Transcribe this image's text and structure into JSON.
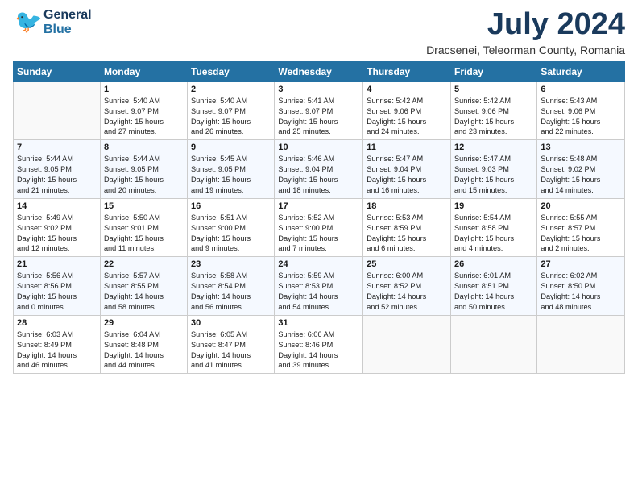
{
  "header": {
    "logo_general": "General",
    "logo_blue": "Blue",
    "month_year": "July 2024",
    "location": "Dracsenei, Teleorman County, Romania"
  },
  "weekdays": [
    "Sunday",
    "Monday",
    "Tuesday",
    "Wednesday",
    "Thursday",
    "Friday",
    "Saturday"
  ],
  "weeks": [
    [
      {
        "day": "",
        "info": ""
      },
      {
        "day": "1",
        "info": "Sunrise: 5:40 AM\nSunset: 9:07 PM\nDaylight: 15 hours\nand 27 minutes."
      },
      {
        "day": "2",
        "info": "Sunrise: 5:40 AM\nSunset: 9:07 PM\nDaylight: 15 hours\nand 26 minutes."
      },
      {
        "day": "3",
        "info": "Sunrise: 5:41 AM\nSunset: 9:07 PM\nDaylight: 15 hours\nand 25 minutes."
      },
      {
        "day": "4",
        "info": "Sunrise: 5:42 AM\nSunset: 9:06 PM\nDaylight: 15 hours\nand 24 minutes."
      },
      {
        "day": "5",
        "info": "Sunrise: 5:42 AM\nSunset: 9:06 PM\nDaylight: 15 hours\nand 23 minutes."
      },
      {
        "day": "6",
        "info": "Sunrise: 5:43 AM\nSunset: 9:06 PM\nDaylight: 15 hours\nand 22 minutes."
      }
    ],
    [
      {
        "day": "7",
        "info": "Sunrise: 5:44 AM\nSunset: 9:05 PM\nDaylight: 15 hours\nand 21 minutes."
      },
      {
        "day": "8",
        "info": "Sunrise: 5:44 AM\nSunset: 9:05 PM\nDaylight: 15 hours\nand 20 minutes."
      },
      {
        "day": "9",
        "info": "Sunrise: 5:45 AM\nSunset: 9:05 PM\nDaylight: 15 hours\nand 19 minutes."
      },
      {
        "day": "10",
        "info": "Sunrise: 5:46 AM\nSunset: 9:04 PM\nDaylight: 15 hours\nand 18 minutes."
      },
      {
        "day": "11",
        "info": "Sunrise: 5:47 AM\nSunset: 9:04 PM\nDaylight: 15 hours\nand 16 minutes."
      },
      {
        "day": "12",
        "info": "Sunrise: 5:47 AM\nSunset: 9:03 PM\nDaylight: 15 hours\nand 15 minutes."
      },
      {
        "day": "13",
        "info": "Sunrise: 5:48 AM\nSunset: 9:02 PM\nDaylight: 15 hours\nand 14 minutes."
      }
    ],
    [
      {
        "day": "14",
        "info": "Sunrise: 5:49 AM\nSunset: 9:02 PM\nDaylight: 15 hours\nand 12 minutes."
      },
      {
        "day": "15",
        "info": "Sunrise: 5:50 AM\nSunset: 9:01 PM\nDaylight: 15 hours\nand 11 minutes."
      },
      {
        "day": "16",
        "info": "Sunrise: 5:51 AM\nSunset: 9:00 PM\nDaylight: 15 hours\nand 9 minutes."
      },
      {
        "day": "17",
        "info": "Sunrise: 5:52 AM\nSunset: 9:00 PM\nDaylight: 15 hours\nand 7 minutes."
      },
      {
        "day": "18",
        "info": "Sunrise: 5:53 AM\nSunset: 8:59 PM\nDaylight: 15 hours\nand 6 minutes."
      },
      {
        "day": "19",
        "info": "Sunrise: 5:54 AM\nSunset: 8:58 PM\nDaylight: 15 hours\nand 4 minutes."
      },
      {
        "day": "20",
        "info": "Sunrise: 5:55 AM\nSunset: 8:57 PM\nDaylight: 15 hours\nand 2 minutes."
      }
    ],
    [
      {
        "day": "21",
        "info": "Sunrise: 5:56 AM\nSunset: 8:56 PM\nDaylight: 15 hours\nand 0 minutes."
      },
      {
        "day": "22",
        "info": "Sunrise: 5:57 AM\nSunset: 8:55 PM\nDaylight: 14 hours\nand 58 minutes."
      },
      {
        "day": "23",
        "info": "Sunrise: 5:58 AM\nSunset: 8:54 PM\nDaylight: 14 hours\nand 56 minutes."
      },
      {
        "day": "24",
        "info": "Sunrise: 5:59 AM\nSunset: 8:53 PM\nDaylight: 14 hours\nand 54 minutes."
      },
      {
        "day": "25",
        "info": "Sunrise: 6:00 AM\nSunset: 8:52 PM\nDaylight: 14 hours\nand 52 minutes."
      },
      {
        "day": "26",
        "info": "Sunrise: 6:01 AM\nSunset: 8:51 PM\nDaylight: 14 hours\nand 50 minutes."
      },
      {
        "day": "27",
        "info": "Sunrise: 6:02 AM\nSunset: 8:50 PM\nDaylight: 14 hours\nand 48 minutes."
      }
    ],
    [
      {
        "day": "28",
        "info": "Sunrise: 6:03 AM\nSunset: 8:49 PM\nDaylight: 14 hours\nand 46 minutes."
      },
      {
        "day": "29",
        "info": "Sunrise: 6:04 AM\nSunset: 8:48 PM\nDaylight: 14 hours\nand 44 minutes."
      },
      {
        "day": "30",
        "info": "Sunrise: 6:05 AM\nSunset: 8:47 PM\nDaylight: 14 hours\nand 41 minutes."
      },
      {
        "day": "31",
        "info": "Sunrise: 6:06 AM\nSunset: 8:46 PM\nDaylight: 14 hours\nand 39 minutes."
      },
      {
        "day": "",
        "info": ""
      },
      {
        "day": "",
        "info": ""
      },
      {
        "day": "",
        "info": ""
      }
    ]
  ]
}
